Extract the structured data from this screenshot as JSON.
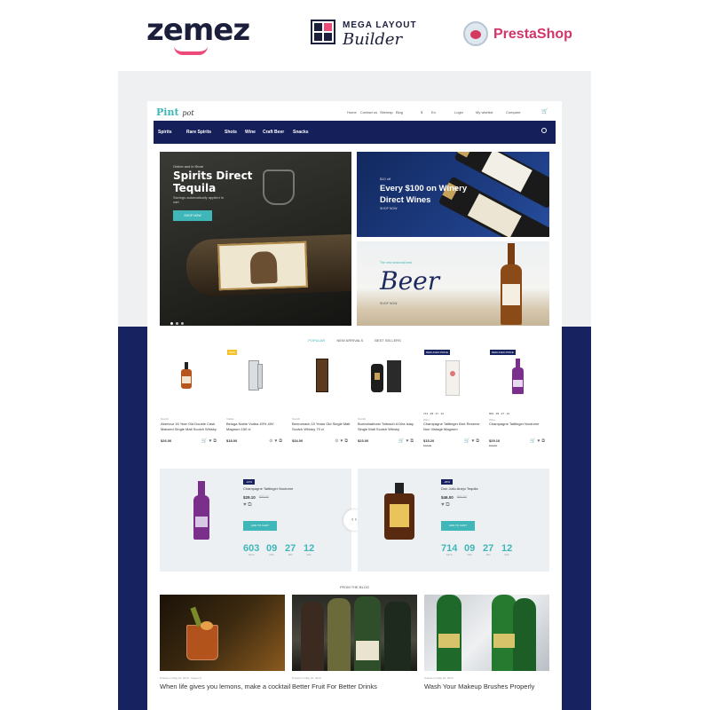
{
  "branding": {
    "zemez": "zemez",
    "mega_line1": "MEGA LAYOUT",
    "mega_line2": "Builder",
    "prestashop": "PrestaShop"
  },
  "header": {
    "logo": "Pint",
    "logo_suffix": "pot",
    "links": [
      "Home",
      "Contact us",
      "Sitemap",
      "Blog"
    ],
    "currency": "$",
    "language": "En",
    "login": "Login",
    "wishlist": "My wishlist",
    "compare": "Compare"
  },
  "nav": {
    "items": [
      "Spirits",
      "Rare Spirits",
      "Shots",
      "Wine",
      "Craft Beer",
      "Snacks"
    ]
  },
  "hero": {
    "main_small": "Online and in Store",
    "main_title": "Spirits Direct Tequila",
    "main_sub": "Savings automatically applied in cart",
    "main_btn": "SHOP NOW",
    "top_small": "$10 off",
    "top_title_1": "Every $100 on Winery",
    "top_title_2": "Direct Wines",
    "top_link": "SHOP NOW",
    "bottom_small": "The new seasonal best",
    "bottom_title": "Beer",
    "bottom_link": "SHOP NOW"
  },
  "tabs": [
    "POPULAR",
    "NEW ARRIVALS",
    "BEST SELLERS"
  ],
  "products": [
    {
      "category": "Scotch",
      "name": "Aberlour 16 Year Old Double Cask Matured Single Malt Scotch Whisky",
      "price": "$26.00",
      "old": "",
      "badge": ""
    },
    {
      "category": "Vodka",
      "name": "Beluga Noble Vodka 40% 40V Magnum 150 cl",
      "price": "$18.00",
      "old": "",
      "badge": "NEW"
    },
    {
      "category": "Scotch",
      "name": "Benromach 10 Years Old Single Malt Scotch Whisky 70 cl",
      "price": "$34.00",
      "old": "",
      "badge": ""
    },
    {
      "category": "Scotch",
      "name": "Bunnahabhain Toiteach A Dha Islay Single Malt Scotch Whisky",
      "price": "$23.00",
      "old": "",
      "badge": ""
    },
    {
      "category": "Wine",
      "name": "Champagne Taittinger Brut Reserve Non Vintage Magnum",
      "price": "$15.20",
      "old": "$19.00",
      "badge": "REDUCED PRICE",
      "timer": "714 · 09 · 27 · 12"
    },
    {
      "category": "Wine",
      "name": "Champagne Taittinger Nocturne",
      "price": "$29.10",
      "old": "$32.00",
      "badge": "REDUCED PRICE",
      "timer": "603 · 09 · 27 · 12"
    }
  ],
  "deals": [
    {
      "badge": "-10%",
      "name": "Champagne Taittinger Nocturne",
      "price": "$29.10",
      "old": "$32.00",
      "btn": "ADD TO CART",
      "days": "603",
      "hours": "09",
      "minutes": "27",
      "seconds": "12"
    },
    {
      "badge": "-20%",
      "name": "Don Julio Anejo Tequila",
      "price": "$46.00",
      "old": "$51.00",
      "btn": "ADD TO CART",
      "days": "714",
      "hours": "09",
      "minutes": "27",
      "seconds": "12"
    }
  ],
  "countdown_labels": [
    "DAYS",
    "HRS",
    "MIN",
    "SEC"
  ],
  "blog": {
    "heading": "FROM THE BLOG",
    "posts": [
      {
        "meta": "Posted on May 22, 2019 · Hayes O.",
        "title": "When life gives you lemons, make a cocktail"
      },
      {
        "meta": "Posted on May 22, 2019",
        "title": "Better Fruit For Better Drinks"
      },
      {
        "meta": "Posted on May 22, 2019",
        "title": "Wash Your Makeup Brushes Properly"
      }
    ]
  },
  "colors": {
    "navy": "#172260",
    "teal": "#3fb6b8",
    "pink": "#ec4b7a"
  }
}
